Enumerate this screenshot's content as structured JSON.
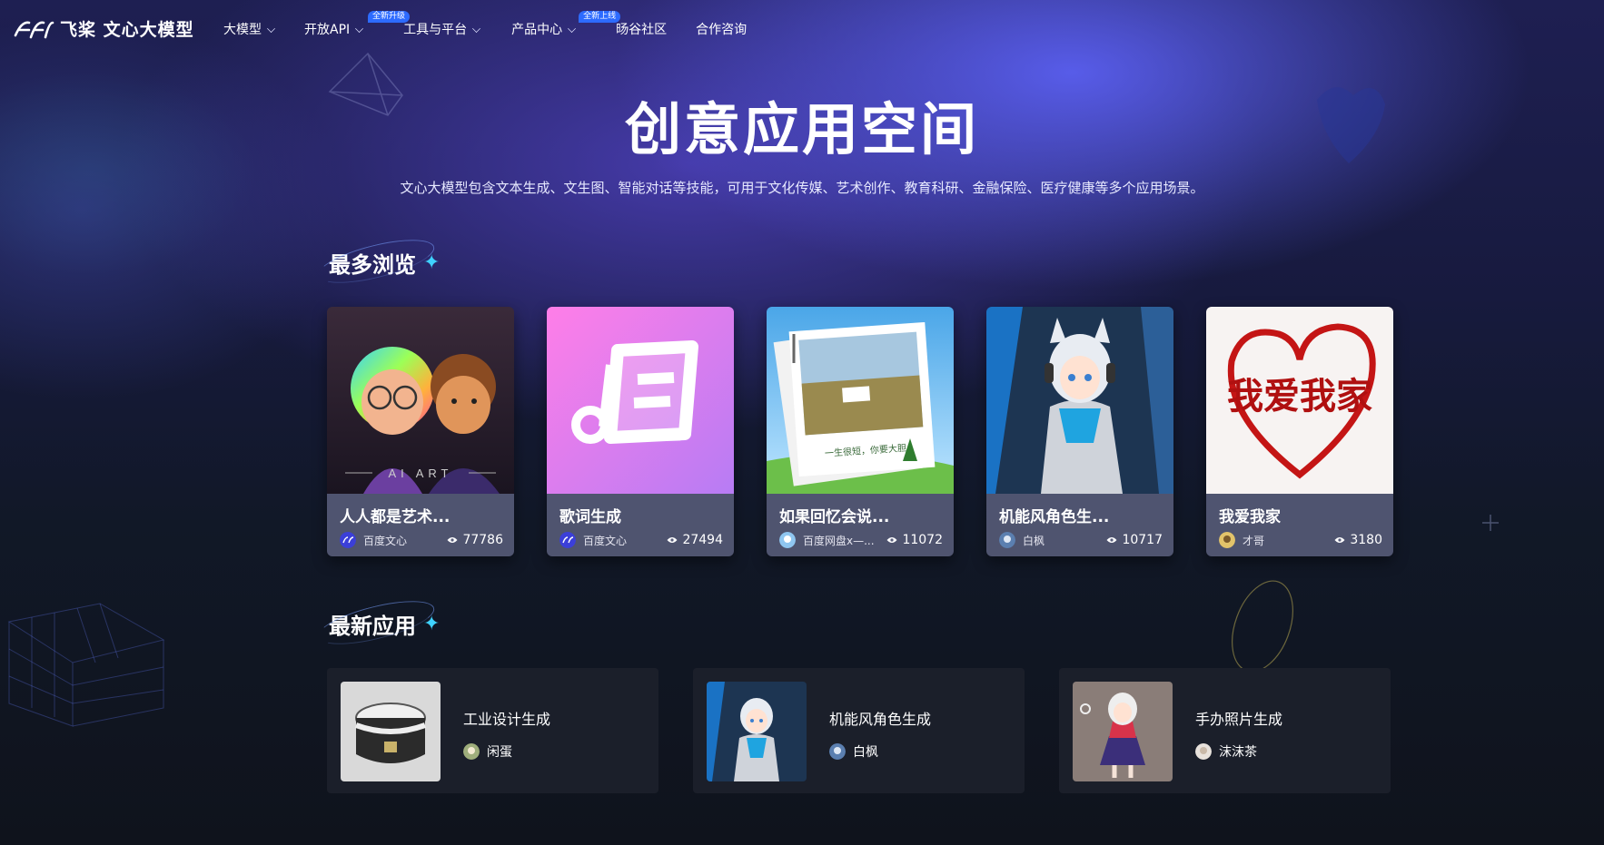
{
  "brand": {
    "name": "飞桨 文心大模型"
  },
  "nav": [
    {
      "label": "大模型",
      "has_dropdown": true,
      "badge": ""
    },
    {
      "label": "开放API",
      "has_dropdown": true,
      "badge": "全新升级"
    },
    {
      "label": "工具与平台",
      "has_dropdown": true,
      "badge": ""
    },
    {
      "label": "产品中心",
      "has_dropdown": true,
      "badge": "全新上线"
    },
    {
      "label": "旸谷社区",
      "has_dropdown": false,
      "badge": ""
    },
    {
      "label": "合作咨询",
      "has_dropdown": false,
      "badge": ""
    }
  ],
  "hero": {
    "title": "创意应用空间",
    "subtitle": "文心大模型包含文本生成、文生图、智能对话等技能，可用于文化传媒、艺术创作、教育科研、金融保险、医疗健康等多个应用场景。"
  },
  "most_viewed": {
    "title": "最多浏览",
    "cards": [
      {
        "title": "人人都是艺术...",
        "author": "百度文心",
        "views": "77786",
        "image": "ai-art-characters",
        "image_text": "AI ART"
      },
      {
        "title": "歌词生成",
        "author": "百度文心",
        "views": "27494",
        "image": "music-note-icon",
        "image_text": ""
      },
      {
        "title": "如果回忆会说...",
        "author": "百度网盘x—...",
        "views": "11072",
        "image": "polaroid-photo",
        "image_text": "一生很短，你要大胆"
      },
      {
        "title": "机能风角色生...",
        "author": "白枫",
        "views": "10717",
        "image": "anime-character",
        "image_text": ""
      },
      {
        "title": "我爱我家",
        "author": "才哥",
        "views": "3180",
        "image": "heart-calligraphy",
        "image_text": "我爱我家"
      }
    ]
  },
  "newest": {
    "title": "最新应用",
    "apps": [
      {
        "name": "工业设计生成",
        "author": "闲蛋",
        "image": "rice-cooker"
      },
      {
        "name": "机能风角色生成",
        "author": "白枫",
        "image": "anime-character"
      },
      {
        "name": "手办照片生成",
        "author": "沫沫茶",
        "image": "figurine"
      }
    ]
  },
  "colors": {
    "accent": "#3fd2ff",
    "badge": "#2d6bff",
    "card_footer": "#5a5f7d",
    "app_bg": "#1b1f2a"
  }
}
